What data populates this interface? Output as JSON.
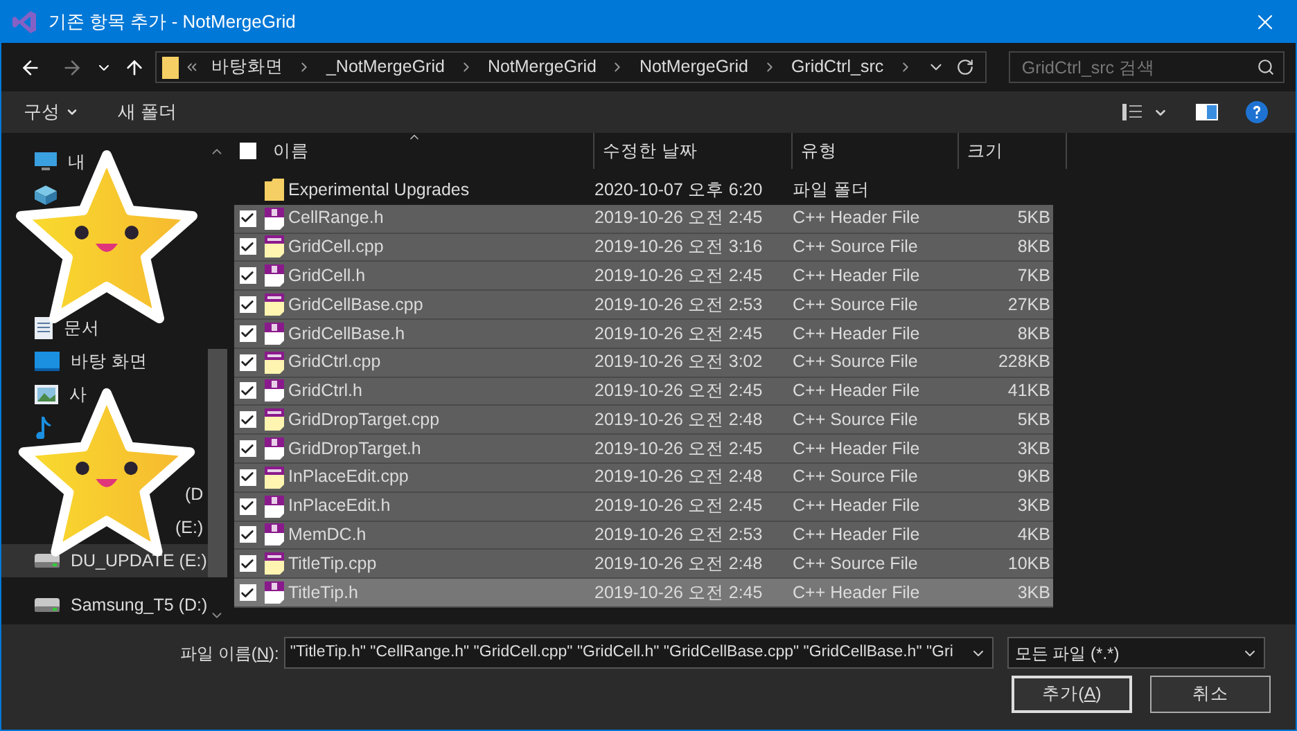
{
  "window": {
    "title": "기존 항목 추가 - NotMergeGrid"
  },
  "nav": {
    "back_disabled": false,
    "forward_disabled": true,
    "breadcrumbs": [
      "바탕화면",
      "_NotMergeGrid",
      "NotMergeGrid",
      "NotMergeGrid",
      "GridCtrl_src"
    ],
    "search": {
      "placeholder": "GridCtrl_src 검색"
    }
  },
  "toolbar": {
    "organize": "구성",
    "new_folder": "새 폴더"
  },
  "sidebar": {
    "items": [
      {
        "kind": "pc",
        "label": "내",
        "selected": false
      },
      {
        "kind": "objects",
        "selected": false
      },
      {
        "kind": "documents",
        "label": "문서",
        "selected": false
      },
      {
        "kind": "desktop",
        "label": "바탕 화면",
        "selected": false
      },
      {
        "kind": "pictures",
        "label": "사",
        "selected": false
      },
      {
        "kind": "music",
        "selected": false
      },
      {
        "kind": "text",
        "label": "(D",
        "selected": false
      },
      {
        "kind": "text",
        "label": "(E:)",
        "selected": false
      },
      {
        "kind": "drive",
        "label": "DU_UPDATE (E:)",
        "selected": true
      },
      {
        "kind": "drive",
        "label": "Samsung_T5 (D:)",
        "selected": false
      }
    ]
  },
  "table": {
    "columns": [
      "이름",
      "수정한 날짜",
      "유형",
      "크기"
    ],
    "select_all_checked": false,
    "rows": [
      {
        "kind": "folder",
        "name": "Experimental Upgrades",
        "date": "2020-10-07 오후 6:20",
        "type": "파일 폴더",
        "checked": false,
        "selected": false,
        "focused": false
      },
      {
        "kind": "header",
        "name": "CellRange.h",
        "date": "2019-10-26 오전 2:45",
        "type": "C++ Header File",
        "size": "5KB",
        "checked": true,
        "selected": true,
        "focused": false
      },
      {
        "kind": "source",
        "name": "GridCell.cpp",
        "date": "2019-10-26 오전 3:16",
        "type": "C++ Source File",
        "size": "8KB",
        "checked": true,
        "selected": true,
        "focused": false
      },
      {
        "kind": "header",
        "name": "GridCell.h",
        "date": "2019-10-26 오전 2:45",
        "type": "C++ Header File",
        "size": "7KB",
        "checked": true,
        "selected": true,
        "focused": false
      },
      {
        "kind": "source",
        "name": "GridCellBase.cpp",
        "date": "2019-10-26 오전 2:53",
        "type": "C++ Source File",
        "size": "27KB",
        "checked": true,
        "selected": true,
        "focused": false
      },
      {
        "kind": "header",
        "name": "GridCellBase.h",
        "date": "2019-10-26 오전 2:45",
        "type": "C++ Header File",
        "size": "8KB",
        "checked": true,
        "selected": true,
        "focused": false
      },
      {
        "kind": "source",
        "name": "GridCtrl.cpp",
        "date": "2019-10-26 오전 3:02",
        "type": "C++ Source File",
        "size": "228KB",
        "checked": true,
        "selected": true,
        "focused": false
      },
      {
        "kind": "header",
        "name": "GridCtrl.h",
        "date": "2019-10-26 오전 2:45",
        "type": "C++ Header File",
        "size": "41KB",
        "checked": true,
        "selected": true,
        "focused": false
      },
      {
        "kind": "source",
        "name": "GridDropTarget.cpp",
        "date": "2019-10-26 오전 2:48",
        "type": "C++ Source File",
        "size": "5KB",
        "checked": true,
        "selected": true,
        "focused": false
      },
      {
        "kind": "header",
        "name": "GridDropTarget.h",
        "date": "2019-10-26 오전 2:45",
        "type": "C++ Header File",
        "size": "3KB",
        "checked": true,
        "selected": true,
        "focused": false
      },
      {
        "kind": "source",
        "name": "InPlaceEdit.cpp",
        "date": "2019-10-26 오전 2:48",
        "type": "C++ Source File",
        "size": "9KB",
        "checked": true,
        "selected": true,
        "focused": false
      },
      {
        "kind": "header",
        "name": "InPlaceEdit.h",
        "date": "2019-10-26 오전 2:45",
        "type": "C++ Header File",
        "size": "3KB",
        "checked": true,
        "selected": true,
        "focused": false
      },
      {
        "kind": "header",
        "name": "MemDC.h",
        "date": "2019-10-26 오전 2:53",
        "type": "C++ Header File",
        "size": "4KB",
        "checked": true,
        "selected": true,
        "focused": false
      },
      {
        "kind": "source",
        "name": "TitleTip.cpp",
        "date": "2019-10-26 오전 2:48",
        "type": "C++ Source File",
        "size": "10KB",
        "checked": true,
        "selected": true,
        "focused": false
      },
      {
        "kind": "header",
        "name": "TitleTip.h",
        "date": "2019-10-26 오전 2:45",
        "type": "C++ Header File",
        "size": "3KB",
        "checked": true,
        "selected": true,
        "focused": true
      }
    ]
  },
  "footer": {
    "filename_label": {
      "before": "파일 이름(",
      "key": "N",
      "after": "):"
    },
    "filename_value": "\"TitleTip.h\" \"CellRange.h\" \"GridCell.cpp\" \"GridCell.h\" \"GridCellBase.cpp\" \"GridCellBase.h\" \"Gri",
    "filter": "모든 파일 (*.*)",
    "buttons": [
      {
        "before": "추가(",
        "key": "A",
        "after": ")"
      },
      {
        "before": "취소"
      }
    ]
  }
}
